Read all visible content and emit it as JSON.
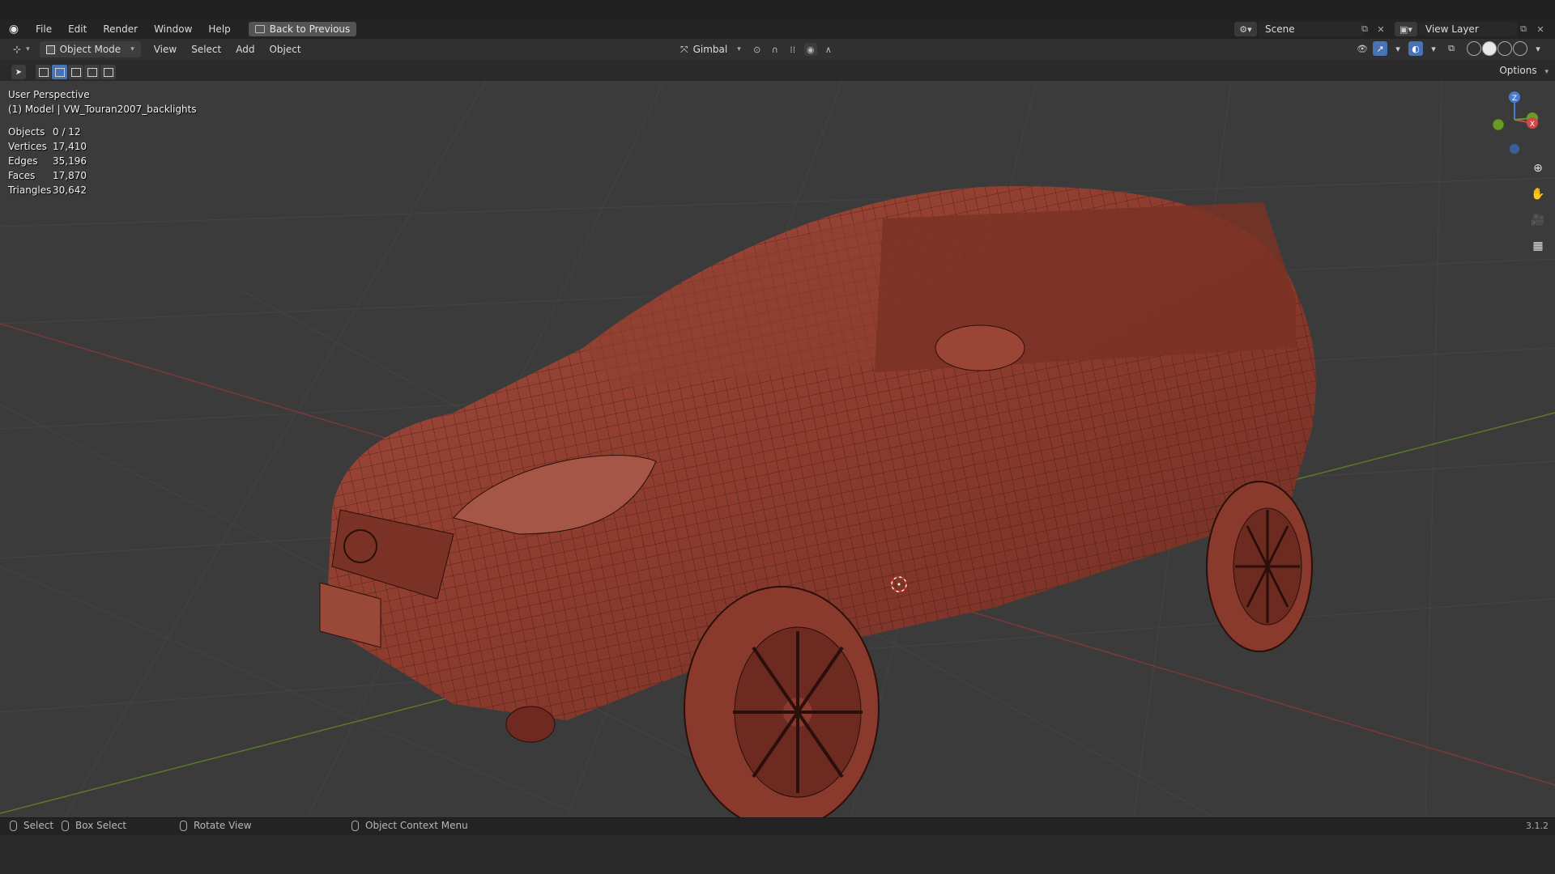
{
  "menu": {
    "items": [
      "File",
      "Edit",
      "Render",
      "Window",
      "Help"
    ],
    "back_button": "Back to Previous"
  },
  "scene": {
    "name": "Scene",
    "view_layer": "View Layer"
  },
  "header": {
    "mode": "Object Mode",
    "menus": [
      "View",
      "Select",
      "Add",
      "Object"
    ],
    "transform_orientation": "Gimbal",
    "options": "Options"
  },
  "viewport": {
    "view_name": "User Perspective",
    "object_path": "(1) Model | VW_Touran2007_backlights",
    "stats": [
      {
        "label": "Objects",
        "value": "0 / 12"
      },
      {
        "label": "Vertices",
        "value": "17,410"
      },
      {
        "label": "Edges",
        "value": "35,196"
      },
      {
        "label": "Faces",
        "value": "17,870"
      },
      {
        "label": "Triangles",
        "value": "30,642"
      }
    ],
    "gizmo": {
      "z": "Z",
      "x": "X",
      "y": "Y"
    }
  },
  "statusbar": {
    "select": "Select",
    "box_select": "Box Select",
    "rotate_view": "Rotate View",
    "context_menu": "Object Context Menu",
    "version": "3.1.2"
  },
  "colors": {
    "model": "#8c3b2e",
    "viewport_bg": "#3b3b3b",
    "accent": "#4772b3",
    "x_axis": "#c04848",
    "y_axis": "#6a9a2a"
  }
}
